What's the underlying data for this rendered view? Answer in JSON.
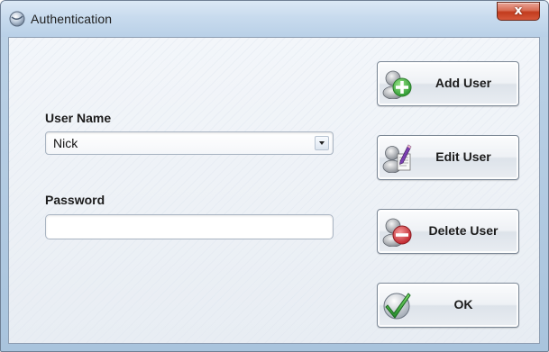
{
  "window": {
    "title": "Authentication",
    "title_icon": "app-globe-icon",
    "close_glyph": "x",
    "close_icon": "close-icon"
  },
  "form": {
    "username_label": "User Name",
    "username_value": "Nick",
    "password_label": "Password",
    "password_value": ""
  },
  "buttons": {
    "add_user": {
      "label": "Add User",
      "icon": "user-add-icon"
    },
    "edit_user": {
      "label": "Edit User",
      "icon": "user-edit-icon"
    },
    "delete_user": {
      "label": "Delete User",
      "icon": "user-delete-icon"
    },
    "ok": {
      "label": "OK",
      "icon": "checkmark-icon"
    }
  },
  "colors": {
    "accent_green": "#3aa83c",
    "delete_red": "#c8323a",
    "close_red": "#c9442a"
  }
}
